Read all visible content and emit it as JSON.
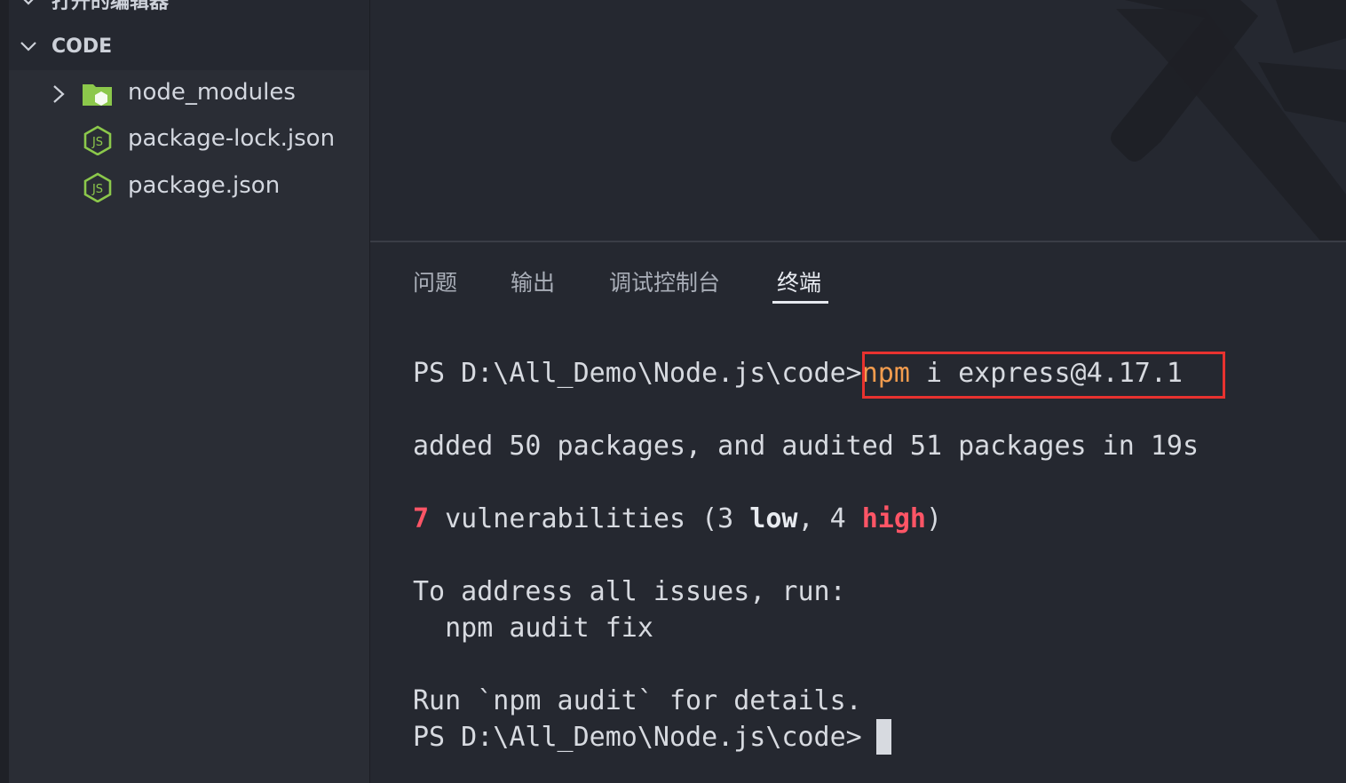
{
  "sidebar": {
    "open_editors_label": "打开的编辑器",
    "workspace_label": "CODE",
    "files": [
      {
        "name": "node_modules",
        "type": "folder",
        "icon": "folder-icon",
        "expanded": false
      },
      {
        "name": "package-lock.json",
        "type": "file",
        "icon": "nodejs-icon"
      },
      {
        "name": "package.json",
        "type": "file",
        "icon": "nodejs-icon"
      }
    ]
  },
  "panel": {
    "tabs": [
      {
        "label": "问题",
        "active": false
      },
      {
        "label": "输出",
        "active": false
      },
      {
        "label": "调试控制台",
        "active": false
      },
      {
        "label": "终端",
        "active": true
      }
    ]
  },
  "terminal": {
    "prompt": "PS D:\\All_Demo\\Node.js\\code>",
    "command_npm": "npm",
    "command_rest": " i express@4.17.1",
    "lines": {
      "added": "added 50 packages, and audited 51 packages in 19s",
      "vuln_count": "7",
      "vuln_text_1": " vulnerabilities (3 ",
      "vuln_low": "low",
      "vuln_text_2": ", 4 ",
      "vuln_high": "high",
      "vuln_text_3": ")",
      "address": "To address all issues, run:",
      "fix_cmd": "  npm audit fix",
      "run_details": "Run `npm audit` for details.",
      "final_prompt": "PS D:\\All_Demo\\Node.js\\code> "
    }
  },
  "colors": {
    "background": "#252830",
    "npm_keyword": "#f39c4e",
    "vulnerability_red": "#ff5566",
    "highlight_box": "#e8322f",
    "node_green": "#8cc84b"
  }
}
